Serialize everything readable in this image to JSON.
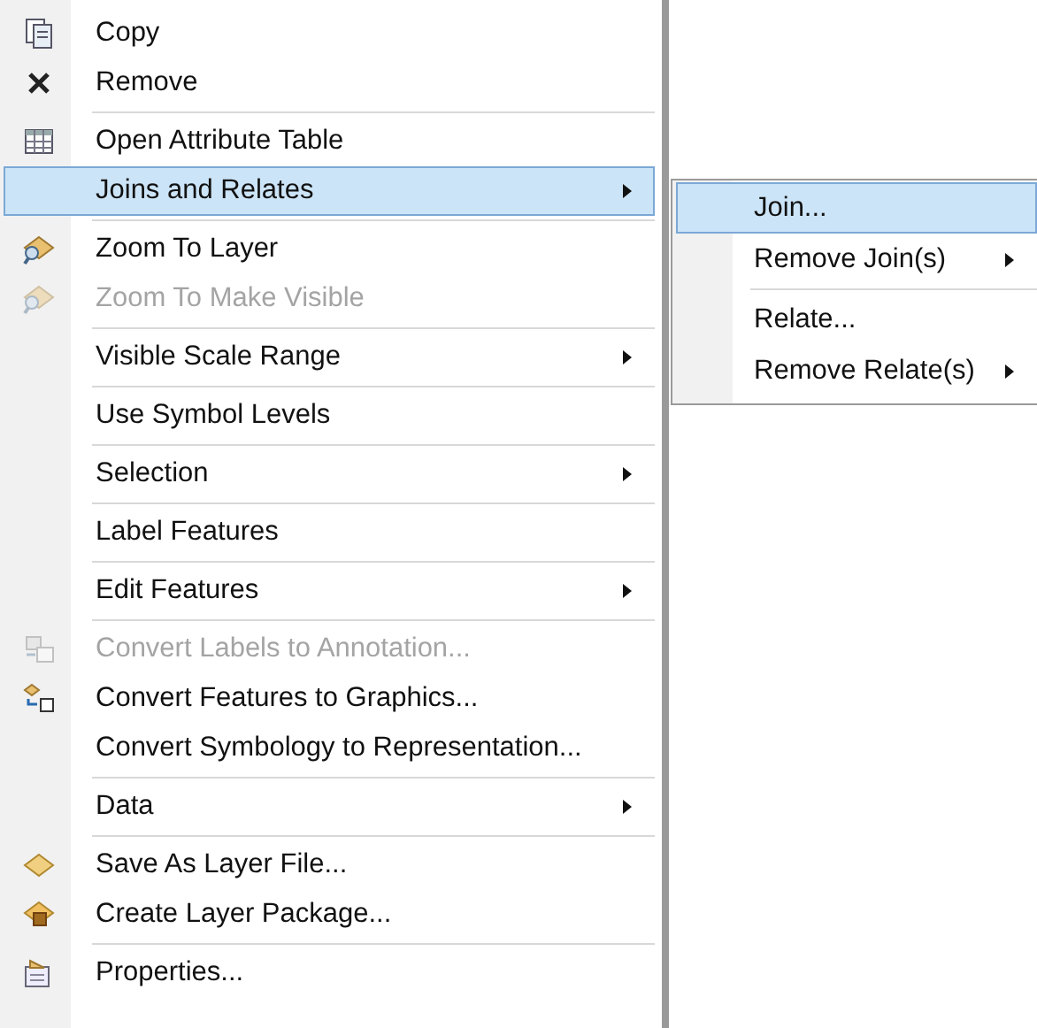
{
  "context_menu": {
    "items": [
      {
        "label": "Copy",
        "disabled": false,
        "submenu": false,
        "selected": false,
        "separator_after": false
      },
      {
        "label": "Remove",
        "disabled": false,
        "submenu": false,
        "selected": false,
        "separator_after": true
      },
      {
        "label": "Open Attribute Table",
        "disabled": false,
        "submenu": false,
        "selected": false,
        "separator_after": false
      },
      {
        "label": "Joins and Relates",
        "disabled": false,
        "submenu": true,
        "selected": true,
        "separator_after": true
      },
      {
        "label": "Zoom To Layer",
        "disabled": false,
        "submenu": false,
        "selected": false,
        "separator_after": false
      },
      {
        "label": "Zoom To Make Visible",
        "disabled": true,
        "submenu": false,
        "selected": false,
        "separator_after": true
      },
      {
        "label": "Visible Scale Range",
        "disabled": false,
        "submenu": true,
        "selected": false,
        "separator_after": true
      },
      {
        "label": "Use Symbol Levels",
        "disabled": false,
        "submenu": false,
        "selected": false,
        "separator_after": true
      },
      {
        "label": "Selection",
        "disabled": false,
        "submenu": true,
        "selected": false,
        "separator_after": true
      },
      {
        "label": "Label Features",
        "disabled": false,
        "submenu": false,
        "selected": false,
        "separator_after": true
      },
      {
        "label": "Edit Features",
        "disabled": false,
        "submenu": true,
        "selected": false,
        "separator_after": true
      },
      {
        "label": "Convert Labels to Annotation...",
        "disabled": true,
        "submenu": false,
        "selected": false,
        "separator_after": false
      },
      {
        "label": "Convert Features to Graphics...",
        "disabled": false,
        "submenu": false,
        "selected": false,
        "separator_after": false
      },
      {
        "label": "Convert Symbology to Representation...",
        "disabled": false,
        "submenu": false,
        "selected": false,
        "separator_after": true
      },
      {
        "label": "Data",
        "disabled": false,
        "submenu": true,
        "selected": false,
        "separator_after": true
      },
      {
        "label": "Save As Layer File...",
        "disabled": false,
        "submenu": false,
        "selected": false,
        "separator_after": false
      },
      {
        "label": "Create Layer Package...",
        "disabled": false,
        "submenu": false,
        "selected": false,
        "separator_after": true
      },
      {
        "label": "Properties...",
        "disabled": false,
        "submenu": false,
        "selected": false,
        "separator_after": false
      }
    ]
  },
  "submenu": {
    "items": [
      {
        "label": "Join...",
        "submenu": false,
        "selected": true,
        "separator_after": false
      },
      {
        "label": "Remove Join(s)",
        "submenu": true,
        "selected": false,
        "separator_after": true
      },
      {
        "label": "Relate...",
        "submenu": false,
        "selected": false,
        "separator_after": false
      },
      {
        "label": "Remove Relate(s)",
        "submenu": true,
        "selected": false,
        "separator_after": false
      }
    ]
  }
}
